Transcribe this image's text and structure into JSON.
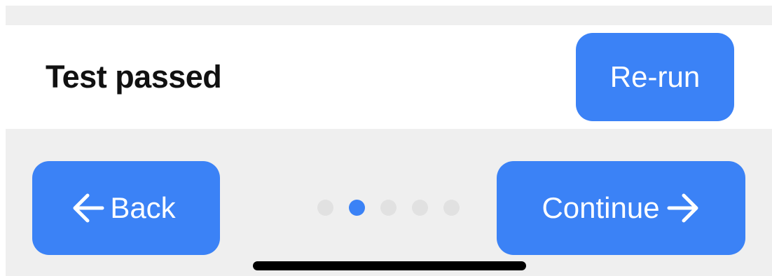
{
  "status": {
    "text": "Test passed"
  },
  "actions": {
    "rerun_label": "Re-run"
  },
  "navigation": {
    "back_label": "Back",
    "continue_label": "Continue",
    "back_icon": "arrow-left-icon",
    "continue_icon": "arrow-right-icon"
  },
  "pagination": {
    "total_pages": 5,
    "current_page": 2
  },
  "colors": {
    "accent": "#3b82f6",
    "panel_background": "#efefef",
    "inactive_dot": "#e1e1e1"
  }
}
